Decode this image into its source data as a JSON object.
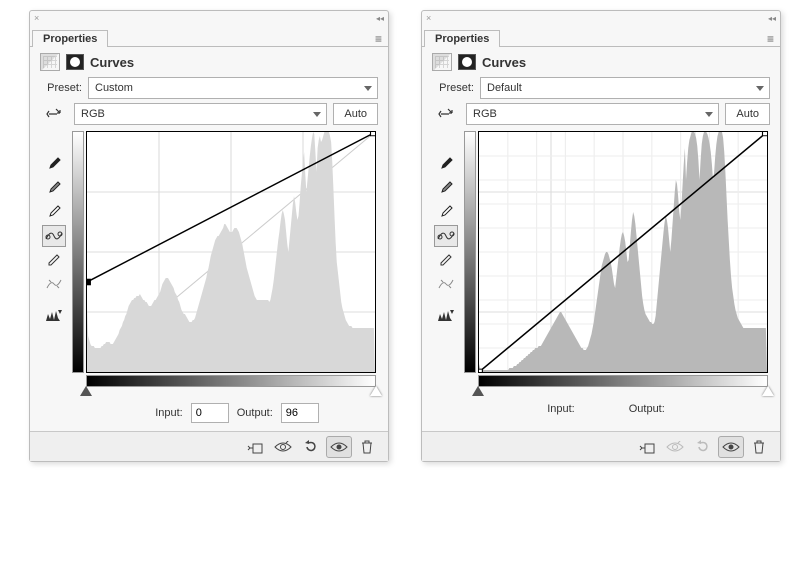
{
  "panels": [
    {
      "tab_label": "Properties",
      "adj_title": "Curves",
      "preset_label": "Preset:",
      "preset_value": "Custom",
      "channel_value": "RGB",
      "auto_label": "Auto",
      "input_label": "Input:",
      "output_label": "Output:",
      "input_value": "0",
      "output_value": "96",
      "has_io_values": true,
      "footer_enabled": true,
      "histogram": [
        33,
        18,
        16,
        14,
        13,
        13,
        13,
        12,
        12,
        12,
        12,
        12,
        12,
        13,
        13,
        14,
        14,
        15,
        15,
        15,
        15,
        14,
        14,
        14,
        15,
        16,
        17,
        18,
        19,
        21,
        22,
        23,
        25,
        26,
        28,
        29,
        31,
        33,
        34,
        35,
        36,
        36,
        37,
        37,
        38,
        38,
        38,
        39,
        38,
        37,
        36,
        36,
        35,
        35,
        34,
        33,
        33,
        33,
        34,
        35,
        36,
        36,
        37,
        38,
        39,
        40,
        42,
        44,
        45,
        46,
        47,
        47,
        47,
        46,
        45,
        44,
        43,
        42,
        40,
        39,
        38,
        36,
        35,
        33,
        31,
        30,
        29,
        29,
        28,
        27,
        26,
        25,
        25,
        25,
        26,
        26,
        27,
        29,
        31,
        33,
        35,
        37,
        39,
        41,
        43,
        45,
        47,
        50,
        52,
        55,
        58,
        60,
        62,
        64,
        66,
        67,
        68,
        68,
        69,
        70,
        71,
        72,
        74,
        74,
        73,
        72,
        71,
        70,
        70,
        70,
        71,
        72,
        72,
        72,
        71,
        70,
        68,
        66,
        64,
        61,
        58,
        55,
        52,
        50,
        48,
        46,
        44,
        42,
        40,
        38,
        37,
        36,
        36,
        36,
        36,
        36,
        36,
        36,
        36,
        36,
        36,
        36,
        35,
        36,
        39,
        42,
        46,
        51,
        56,
        61,
        66,
        70,
        75,
        79,
        81,
        79,
        76,
        70,
        64,
        60,
        66,
        72,
        78,
        84,
        88,
        85,
        80,
        76,
        78,
        85,
        93,
        99,
        105,
        110,
        99,
        90,
        96,
        102,
        108,
        113,
        117,
        120,
        119,
        110,
        100,
        112,
        116,
        118,
        115,
        116,
        118,
        120,
        120,
        120,
        120,
        120,
        118,
        115,
        105,
        92,
        78,
        65,
        55,
        50,
        45,
        40,
        35,
        32,
        30,
        28,
        26,
        25,
        24,
        23,
        23,
        23,
        22,
        22,
        22,
        22,
        22,
        22,
        22,
        22,
        22,
        22,
        22,
        22,
        22,
        22,
        22,
        22,
        22,
        22,
        22,
        22
      ],
      "curve": {
        "start": [
          0,
          96
        ],
        "end": [
          255,
          255
        ]
      }
    },
    {
      "tab_label": "Properties",
      "adj_title": "Curves",
      "preset_label": "Preset:",
      "preset_value": "Default",
      "channel_value": "RGB",
      "auto_label": "Auto",
      "input_label": "Input:",
      "output_label": "Output:",
      "input_value": "",
      "output_value": "",
      "has_io_values": false,
      "footer_enabled": false,
      "histogram": [
        4,
        2,
        1,
        1,
        1,
        1,
        1,
        1,
        1,
        1,
        1,
        1,
        1,
        1,
        1,
        1,
        1,
        1,
        1,
        1,
        1,
        1,
        1,
        1,
        1,
        1,
        1,
        2,
        2,
        2,
        2,
        3,
        3,
        3,
        4,
        4,
        5,
        5,
        6,
        6,
        7,
        7,
        8,
        8,
        9,
        9,
        10,
        10,
        11,
        11,
        12,
        12,
        12,
        13,
        13,
        13,
        14,
        15,
        16,
        17,
        18,
        19,
        20,
        21,
        22,
        23,
        24,
        25,
        26,
        27,
        28,
        29,
        30,
        30,
        29,
        28,
        27,
        26,
        25,
        24,
        23,
        22,
        21,
        20,
        19,
        18,
        17,
        16,
        15,
        14,
        13,
        12,
        12,
        11,
        11,
        11,
        12,
        13,
        15,
        17,
        19,
        22,
        25,
        29,
        33,
        37,
        41,
        45,
        49,
        53,
        55,
        57,
        59,
        60,
        60,
        59,
        57,
        55,
        52,
        48,
        44,
        42,
        47,
        52,
        57,
        62,
        66,
        69,
        70,
        68,
        65,
        60,
        55,
        56,
        63,
        70,
        76,
        80,
        78,
        74,
        68,
        62,
        56,
        50,
        44,
        38,
        34,
        31,
        29,
        28,
        27,
        26,
        25,
        25,
        24,
        24,
        25,
        28,
        34,
        40,
        46,
        52,
        58,
        64,
        70,
        75,
        78,
        76,
        72,
        66,
        60,
        66,
        74,
        82,
        90,
        96,
        94,
        88,
        80,
        76,
        84,
        94,
        104,
        112,
        96,
        105,
        112,
        116,
        118,
        120,
        120,
        120,
        119,
        117,
        113,
        106,
        96,
        106,
        114,
        118,
        120,
        120,
        120,
        119,
        117,
        114,
        110,
        104,
        96,
        100,
        108,
        114,
        118,
        120,
        120,
        120,
        120,
        117,
        110,
        100,
        88,
        76,
        66,
        56,
        48,
        42,
        38,
        34,
        31,
        29,
        27,
        26,
        25,
        24,
        23,
        22,
        22,
        22,
        22,
        22,
        22,
        22,
        22,
        22,
        22,
        22,
        22,
        22,
        22,
        22,
        22,
        22,
        22,
        22,
        22,
        22
      ],
      "curve": {
        "start": [
          0,
          0
        ],
        "end": [
          255,
          255
        ]
      }
    }
  ],
  "icons": {
    "scrubby": "scrubby-icon",
    "eyedropper_black": "eyedropper-black-icon",
    "eyedropper_gray": "eyedropper-gray-icon",
    "eyedropper_white": "eyedropper-white-icon",
    "direct_curve": "direct-curve-icon",
    "pencil": "pencil-icon",
    "smooth": "smooth-icon",
    "clip_warn": "clip-warning-icon",
    "clip_mask": "clip-mask-icon",
    "view_prev": "view-previous-icon",
    "reset": "reset-icon",
    "visibility": "visibility-icon",
    "trash": "trash-icon",
    "menu": "menu-icon"
  }
}
